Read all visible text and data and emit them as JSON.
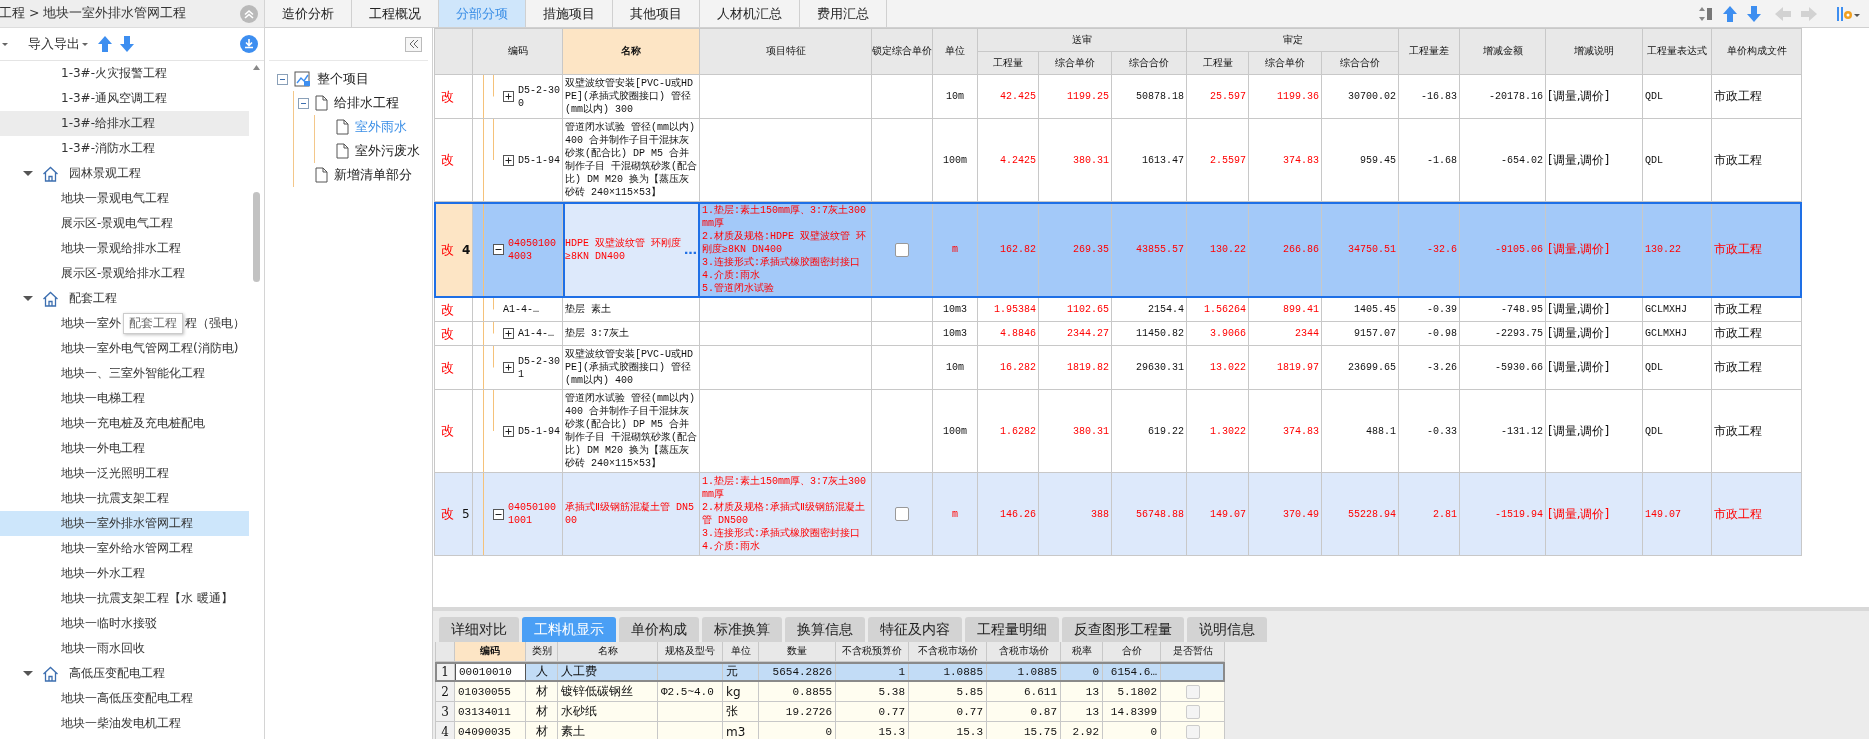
{
  "sidebar": {
    "breadcrumb": "工程 > 地块一室外排水管网工程",
    "menu": "导入导出",
    "items": [
      {
        "label": "1-3#-火灾报警工程",
        "selected": false,
        "hovered": false
      },
      {
        "label": "1-3#-通风空调工程",
        "selected": false,
        "hovered": false
      },
      {
        "label": "1-3#-给排水工程",
        "selected": false,
        "hovered": true
      },
      {
        "label": "1-3#-消防水工程",
        "selected": false,
        "hovered": false
      },
      {
        "label": "园林景观工程",
        "expanded": true,
        "selected": false,
        "hovered": false,
        "children": [
          {
            "label": "地块一景观电气工程",
            "selected": false,
            "hovered": false
          },
          {
            "label": "展示区-景观电气工程",
            "selected": false,
            "hovered": false
          },
          {
            "label": "地块一景观给排水工程",
            "selected": false,
            "hovered": false
          },
          {
            "label": "展示区-景观给排水工程",
            "selected": false,
            "hovered": false
          }
        ]
      },
      {
        "label": "配套工程",
        "expanded": true,
        "selected": false,
        "hovered": false,
        "children": [
          {
            "label_parts": [
              "地块一室外",
              "程（强电）"
            ],
            "tooltip": "配套工程",
            "selected": false,
            "hovered": false
          },
          {
            "label": "地块一室外电气管网工程(消防电)",
            "selected": false,
            "hovered": false
          },
          {
            "label": "地块一、三室外智能化工程",
            "selected": false,
            "hovered": false
          },
          {
            "label": "地块一电梯工程",
            "selected": false,
            "hovered": false
          },
          {
            "label": "地块一充电桩及充电桩配电",
            "selected": false,
            "hovered": false
          },
          {
            "label": "地块一外电工程",
            "selected": false,
            "hovered": false
          },
          {
            "label": "地块一泛光照明工程",
            "selected": false,
            "hovered": false
          },
          {
            "label": "地块一抗震支架工程",
            "selected": false,
            "hovered": false
          },
          {
            "label": "地块一室外排水管网工程",
            "selected": true,
            "hovered": false
          },
          {
            "label": "地块一室外给水管网工程",
            "selected": false,
            "hovered": false
          },
          {
            "label": "地块一外水工程",
            "selected": false,
            "hovered": false
          },
          {
            "label": "地块一抗震支架工程【水 暖通】",
            "selected": false,
            "hovered": false
          },
          {
            "label": "地块一临时水接驳",
            "selected": false,
            "hovered": false
          },
          {
            "label": "地块一雨水回收",
            "selected": false,
            "hovered": false
          }
        ]
      },
      {
        "label": "高低压变配电工程",
        "expanded": true,
        "selected": false,
        "hovered": false,
        "children": [
          {
            "label": "地块一高低压变配电工程",
            "selected": false,
            "hovered": false
          },
          {
            "label": "地块一柴油发电机工程",
            "selected": false,
            "hovered": false
          }
        ]
      }
    ]
  },
  "tabs": [
    {
      "label": "造价分析",
      "selected": false
    },
    {
      "label": "工程概况",
      "selected": false
    },
    {
      "label": "分部分项",
      "selected": true
    },
    {
      "label": "措施项目",
      "selected": false
    },
    {
      "label": "其他项目",
      "selected": false
    },
    {
      "label": "人材机汇总",
      "selected": false
    },
    {
      "label": "费用汇总",
      "selected": false
    }
  ],
  "toolbar": [
    {
      "kind": "sort",
      "disabled": false
    },
    {
      "kind": "up",
      "disabled": false
    },
    {
      "kind": "down",
      "disabled": false
    },
    {
      "kind": "left",
      "disabled": true
    },
    {
      "kind": "right",
      "disabled": true
    },
    {
      "kind": "columns",
      "disabled": false
    }
  ],
  "tree": {
    "items": [
      {
        "label": "整个项目",
        "kind": "project",
        "expanded": true,
        "selected": false,
        "children": [
          {
            "label": "给排水工程",
            "kind": "document",
            "expanded": true,
            "selected": false,
            "children": [
              {
                "label": "室外雨水",
                "kind": "document",
                "selected": true
              },
              {
                "label": "室外污废水",
                "kind": "document",
                "selected": false
              }
            ]
          },
          {
            "label": "新增清单部分",
            "kind": "document",
            "selected": false
          }
        ]
      }
    ]
  },
  "table": {
    "columns": [
      {
        "label": "编码",
        "selected": false
      },
      {
        "label": "名称",
        "selected": true
      },
      {
        "label": "项目特征",
        "selected": false
      },
      {
        "label": "锁定综合单价",
        "selected": false
      },
      {
        "label": "单位",
        "selected": false
      },
      {
        "label": "送审",
        "children": [
          {
            "label": "工程量",
            "selected": false
          },
          {
            "label": "综合单价",
            "selected": false
          },
          {
            "label": "综合合价",
            "selected": false
          }
        ]
      },
      {
        "label": "审定",
        "children": [
          {
            "label": "工程量",
            "selected": false
          },
          {
            "label": "综合单价",
            "selected": false
          },
          {
            "label": "综合合价",
            "selected": false
          }
        ]
      },
      {
        "label": "工程量差",
        "selected": false
      },
      {
        "label": "增减金额",
        "selected": false
      },
      {
        "label": "增减说明",
        "selected": false
      },
      {
        "label": "工程量表达式",
        "selected": false
      },
      {
        "label": "单价构成文件",
        "selected": false
      }
    ],
    "rows": [
      {
        "kind": "quota",
        "mark": "改",
        "selected": false,
        "expanded": false,
        "code": "D5-2-300",
        "name": "双壁波纹管安装[PVC-U或HDPE](承插式胶圈接口) 管径(mm以内) 300",
        "unit": "10m",
        "values": [
          "42.425",
          "1199.25",
          "50878.18",
          "25.597",
          "1199.36",
          "30700.02",
          "-16.83",
          "-20178.16"
        ],
        "note": "[调量,调价]",
        "expression": "QDL",
        "price_file": "市政工程"
      },
      {
        "kind": "quota",
        "mark": "改",
        "selected": false,
        "expanded": false,
        "code": "D5-1-94",
        "name": "管道闭水试验 管径(mm以内) 400  合并制作子目干混抹灰砂浆(配合比) DP M5  合并制作子目 干混砌筑砂浆(配合比) DM M20 换为【蒸压灰砂砖 240×115×53】",
        "unit": "100m",
        "values": [
          "4.2425",
          "380.31",
          "1613.47",
          "2.5597",
          "374.83",
          "959.45",
          "-1.68",
          "-654.02"
        ],
        "note": "[调量,调价]",
        "expression": "QDL",
        "price_file": "市政工程"
      },
      {
        "kind": "bill",
        "mark": "改",
        "number": "4",
        "selected": true,
        "expanded": true,
        "code": "040501004003",
        "name": "HDPE 双壁波纹管 环刚度≥8KN DN400",
        "edit_button": "…",
        "features": [
          "1.垫层:素土150mm厚、3:7灰土300mm厚",
          "2.材质及规格:HDPE 双壁波纹管 环刚度≥8KN DN400",
          "3.连接形式:承插式橡胶圈密封接口",
          "4.介质:雨水",
          "5.管道闭水试验"
        ],
        "locked": false,
        "unit": "m",
        "values": [
          "162.82",
          "269.35",
          "43855.57",
          "130.22",
          "266.86",
          "34750.51",
          "-32.6",
          "-9105.06"
        ],
        "note": "[调量,调价]",
        "expression": "130.22",
        "price_file": "市政工程"
      },
      {
        "kind": "quota",
        "mark": "改",
        "selected": false,
        "code": "A1-4-…",
        "name": "垫层 素土",
        "unit": "10m3",
        "values": [
          "1.95384",
          "1102.65",
          "2154.4",
          "1.56264",
          "899.41",
          "1405.45",
          "-0.39",
          "-748.95"
        ],
        "note": "[调量,调价]",
        "expression": "GCLMXHJ",
        "price_file": "市政工程"
      },
      {
        "kind": "quota",
        "mark": "改",
        "selected": false,
        "expanded": false,
        "code": "A1-4-…",
        "name": "垫层 3:7灰土",
        "unit": "10m3",
        "values": [
          "4.8846",
          "2344.27",
          "11450.82",
          "3.9066",
          "2344",
          "9157.07",
          "-0.98",
          "-2293.75"
        ],
        "note": "[调量,调价]",
        "expression": "GCLMXHJ",
        "price_file": "市政工程"
      },
      {
        "kind": "quota",
        "mark": "改",
        "selected": false,
        "expanded": false,
        "code": "D5-2-301",
        "name": "双壁波纹管安装[PVC-U或HDPE](承插式胶圈接口) 管径(mm以内) 400",
        "unit": "10m",
        "values": [
          "16.282",
          "1819.82",
          "29630.31",
          "13.022",
          "1819.97",
          "23699.65",
          "-3.26",
          "-5930.66"
        ],
        "note": "[调量,调价]",
        "expression": "QDL",
        "price_file": "市政工程"
      },
      {
        "kind": "quota",
        "mark": "改",
        "selected": false,
        "expanded": false,
        "code": "D5-1-94",
        "name": "管道闭水试验 管径(mm以内) 400  合并制作子目干混抹灰砂浆(配合比) DP M5  合并制作子目 干混砌筑砂浆(配合比) DM M20 换为【蒸压灰砂砖 240×115×53】",
        "unit": "100m",
        "values": [
          "1.6282",
          "380.31",
          "619.22",
          "1.3022",
          "374.83",
          "488.1",
          "-0.33",
          "-131.12"
        ],
        "note": "[调量,调价]",
        "expression": "QDL",
        "price_file": "市政工程"
      },
      {
        "kind": "bill",
        "mark": "改",
        "number": "5",
        "selected": false,
        "expanded": true,
        "code": "040501001001",
        "name": "承插式Ⅱ级钢筋混凝土管 DN500",
        "features": [
          "1.垫层:素土150mm厚、3:7灰土300mm厚",
          "2.材质及规格:承插式Ⅱ级钢筋混凝土管 DN500",
          "3.连接形式:承插式橡胶圈密封接口",
          "4.介质:雨水"
        ],
        "locked": false,
        "unit": "m",
        "values": [
          "146.26",
          "388",
          "56748.88",
          "149.07",
          "370.49",
          "55228.94",
          "2.81",
          "-1519.94"
        ],
        "note": "[调量,调价]",
        "expression": "149.07",
        "price_file": "市政工程"
      }
    ]
  },
  "detail": {
    "tabs": [
      {
        "label": "详细对比",
        "selected": false
      },
      {
        "label": "工料机显示",
        "selected": true
      },
      {
        "label": "单价构成",
        "selected": false
      },
      {
        "label": "标准换算",
        "selected": false
      },
      {
        "label": "换算信息",
        "selected": false
      },
      {
        "label": "特征及内容",
        "selected": false
      },
      {
        "label": "工程量明细",
        "selected": false
      },
      {
        "label": "反查图形工程量",
        "selected": false
      },
      {
        "label": "说明信息",
        "selected": false
      }
    ],
    "columns": [
      {
        "label": "编码",
        "selected": true
      },
      {
        "label": "类别",
        "selected": false
      },
      {
        "label": "名称",
        "selected": false
      },
      {
        "label": "规格及型号",
        "selected": false
      },
      {
        "label": "单位",
        "selected": false
      },
      {
        "label": "数量",
        "selected": false
      },
      {
        "label": "不含税预算价",
        "selected": false
      },
      {
        "label": "不含税市场价",
        "selected": false
      },
      {
        "label": "含税市场价",
        "selected": false
      },
      {
        "label": "税率",
        "selected": false
      },
      {
        "label": "合价",
        "selected": false
      },
      {
        "label": "是否暂估",
        "selected": false
      }
    ],
    "rows": [
      {
        "number": "1",
        "selected": true,
        "code": "00010010",
        "category": "人",
        "name": "人工费",
        "unit": "元",
        "quantity": "5654.2826",
        "budget_price": "1",
        "market_price": "1.0885",
        "tax_price": "1.0885",
        "tax_rate": "0",
        "total": "6154.6…"
      },
      {
        "number": "2",
        "selected": false,
        "code": "01030055",
        "category": "材",
        "name": "镀锌低碳钢丝",
        "spec": "Φ2.5~4.0",
        "unit": "kg",
        "quantity": "0.8855",
        "budget_price": "5.38",
        "market_price": "5.85",
        "tax_price": "6.611",
        "tax_rate": "13",
        "total": "5.1802",
        "provisional": false
      },
      {
        "number": "3",
        "selected": false,
        "code": "03134011",
        "category": "材",
        "name": "水砂纸",
        "unit": "张",
        "quantity": "19.2726",
        "budget_price": "0.77",
        "market_price": "0.77",
        "tax_price": "0.87",
        "tax_rate": "13",
        "total": "14.8399",
        "provisional": false
      },
      {
        "number": "4",
        "selected": false,
        "code": "04090035",
        "category": "材",
        "name": "素土",
        "unit": "m3",
        "quantity": "0",
        "budget_price": "15.3",
        "market_price": "15.3",
        "tax_price": "15.75",
        "tax_rate": "2.92",
        "total": "0",
        "provisional": false
      }
    ]
  }
}
